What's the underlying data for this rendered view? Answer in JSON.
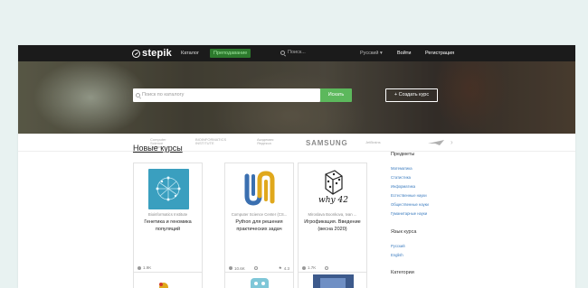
{
  "app": {
    "logo": "stepik"
  },
  "topbar": {
    "catalog": "Каталог",
    "teaching": "Преподавание",
    "search_placeholder": "Поиск...",
    "language": "Русский",
    "login": "Войти",
    "register": "Регистрация"
  },
  "hero": {
    "search_placeholder": "Поиск по каталогу",
    "search_button": "Искать",
    "create_course": "Создать курс"
  },
  "partners": {
    "p1": "Computer Science Center",
    "p2": "BIOINFORMATICS INSTITUTE",
    "p3": "Академия Яндекса",
    "samsung": "SAMSUNG",
    "p5": "JetBrains",
    "chevron": "›"
  },
  "main": {
    "section_title": "Новые курсы"
  },
  "courses": [
    {
      "author": "Bioinformatics Institute",
      "title": "Генетика и геномика популяций",
      "learners": "1.9K",
      "hours": "",
      "rating": ""
    },
    {
      "author": "Computer Science Center (CS...",
      "title": "Python для решения практических задач",
      "learners": "10.6K",
      "hours": "",
      "rating": "4.3"
    },
    {
      "author": "Miroslava Boonkova, Ivan ...",
      "title": "Игрофикация. Введение (весна 2020)",
      "learners": "1.7K",
      "hours": "",
      "rating": "",
      "image_text": "why 42"
    }
  ],
  "sidebar": {
    "subjects_title": "Предметы",
    "subjects": [
      "Математика",
      "Статистика",
      "Информатика",
      "Естественные науки",
      "Общественные науки",
      "Гуманитарные науки"
    ],
    "lang_title": "Язык курса",
    "languages": [
      "Русский",
      "English"
    ],
    "categories_title": "Категории"
  },
  "colors": {
    "accent_green": "#5cb85c",
    "link_blue": "#3a7bbf",
    "topbar": "#1b1b1b"
  }
}
